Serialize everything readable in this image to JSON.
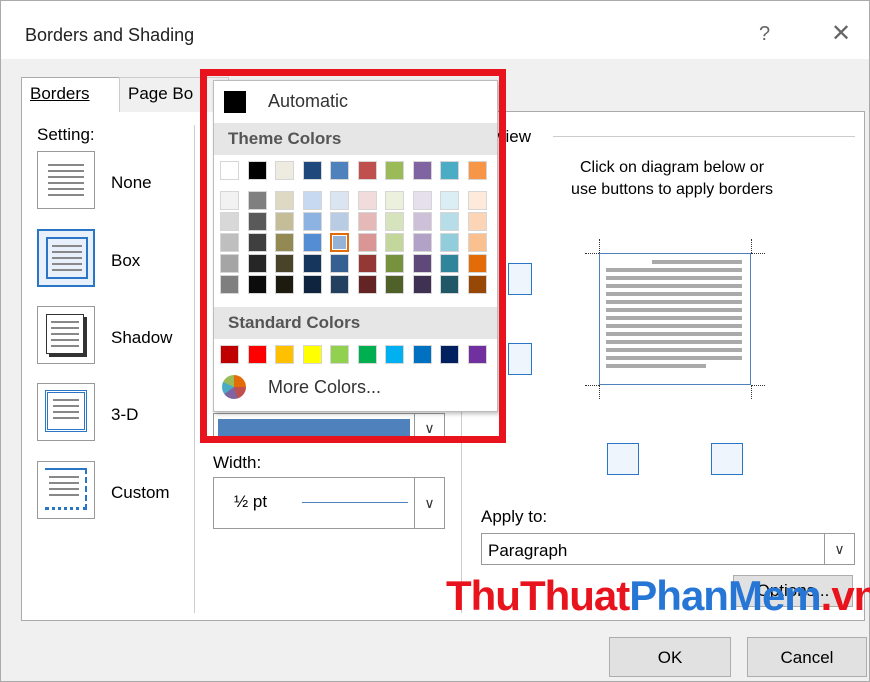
{
  "window": {
    "title": "Borders and Shading",
    "help_glyph": "?",
    "close_glyph": "✕"
  },
  "tabs": [
    {
      "label": "Borders",
      "active": true
    },
    {
      "label": "Page Bo",
      "active": false
    }
  ],
  "setting": {
    "heading": "Setting:",
    "items": [
      {
        "label": "None",
        "icon": "setting-none-icon"
      },
      {
        "label": "Box",
        "icon": "setting-box-icon",
        "selected": true
      },
      {
        "label": "Shadow",
        "icon": "setting-shadow-icon"
      },
      {
        "label": "3-D",
        "icon": "setting-3d-icon"
      },
      {
        "label": "Custom",
        "icon": "setting-custom-icon"
      }
    ]
  },
  "color_popup": {
    "automatic": "Automatic",
    "theme_heading": "Theme Colors",
    "standard_heading": "Standard Colors",
    "more_colors": "More Colors...",
    "theme_top": [
      "#ffffff",
      "#000000",
      "#eeece1",
      "#1f497d",
      "#4f81bd",
      "#c0504d",
      "#9bbb59",
      "#8064a2",
      "#4bacc6",
      "#f79646"
    ],
    "theme_shades": [
      [
        "#f2f2f2",
        "#7f7f7f",
        "#ddd9c3",
        "#c6d9f0",
        "#dbe5f1",
        "#f2dcdb",
        "#ebf1dd",
        "#e5e0ec",
        "#dbeef3",
        "#fdeada"
      ],
      [
        "#d8d8d8",
        "#595959",
        "#c4bd97",
        "#8db3e2",
        "#b8cce4",
        "#e5b9b7",
        "#d7e3bc",
        "#ccc1d9",
        "#b7dde8",
        "#fbd5b5"
      ],
      [
        "#bfbfbf",
        "#3f3f3f",
        "#938953",
        "#548dd4",
        "#95b3d7",
        "#d99694",
        "#c3d69b",
        "#b2a2c7",
        "#92cddc",
        "#fac08f"
      ],
      [
        "#a5a5a5",
        "#262626",
        "#494429",
        "#17365d",
        "#366092",
        "#953734",
        "#76923c",
        "#5f497a",
        "#31859b",
        "#e36c09"
      ],
      [
        "#7f7f7f",
        "#0c0c0c",
        "#1d1b10",
        "#0f243e",
        "#244061",
        "#632423",
        "#4f6128",
        "#3f3151",
        "#205867",
        "#974806"
      ]
    ],
    "selected_swatch": {
      "row": 2,
      "col": 4
    },
    "standard": [
      "#c00000",
      "#ff0000",
      "#ffc000",
      "#ffff00",
      "#92d050",
      "#00b050",
      "#00b0f0",
      "#0070c0",
      "#002060",
      "#7030a0"
    ]
  },
  "color_combo": {
    "value_color": "#4f81bd"
  },
  "width": {
    "label": "Width:",
    "value": "½ pt"
  },
  "preview": {
    "heading_visible": "view",
    "instructions_line1": "Click on diagram below or",
    "instructions_line2": "use buttons to apply borders"
  },
  "apply_to": {
    "label": "Apply to:",
    "value": "Paragraph"
  },
  "options_button": {
    "label": "Options..."
  },
  "buttons": {
    "ok": "OK",
    "cancel": "Cancel"
  },
  "watermark": {
    "part1": "ThuThuat",
    "part2": "PhanMem",
    "part3": ".vn"
  }
}
